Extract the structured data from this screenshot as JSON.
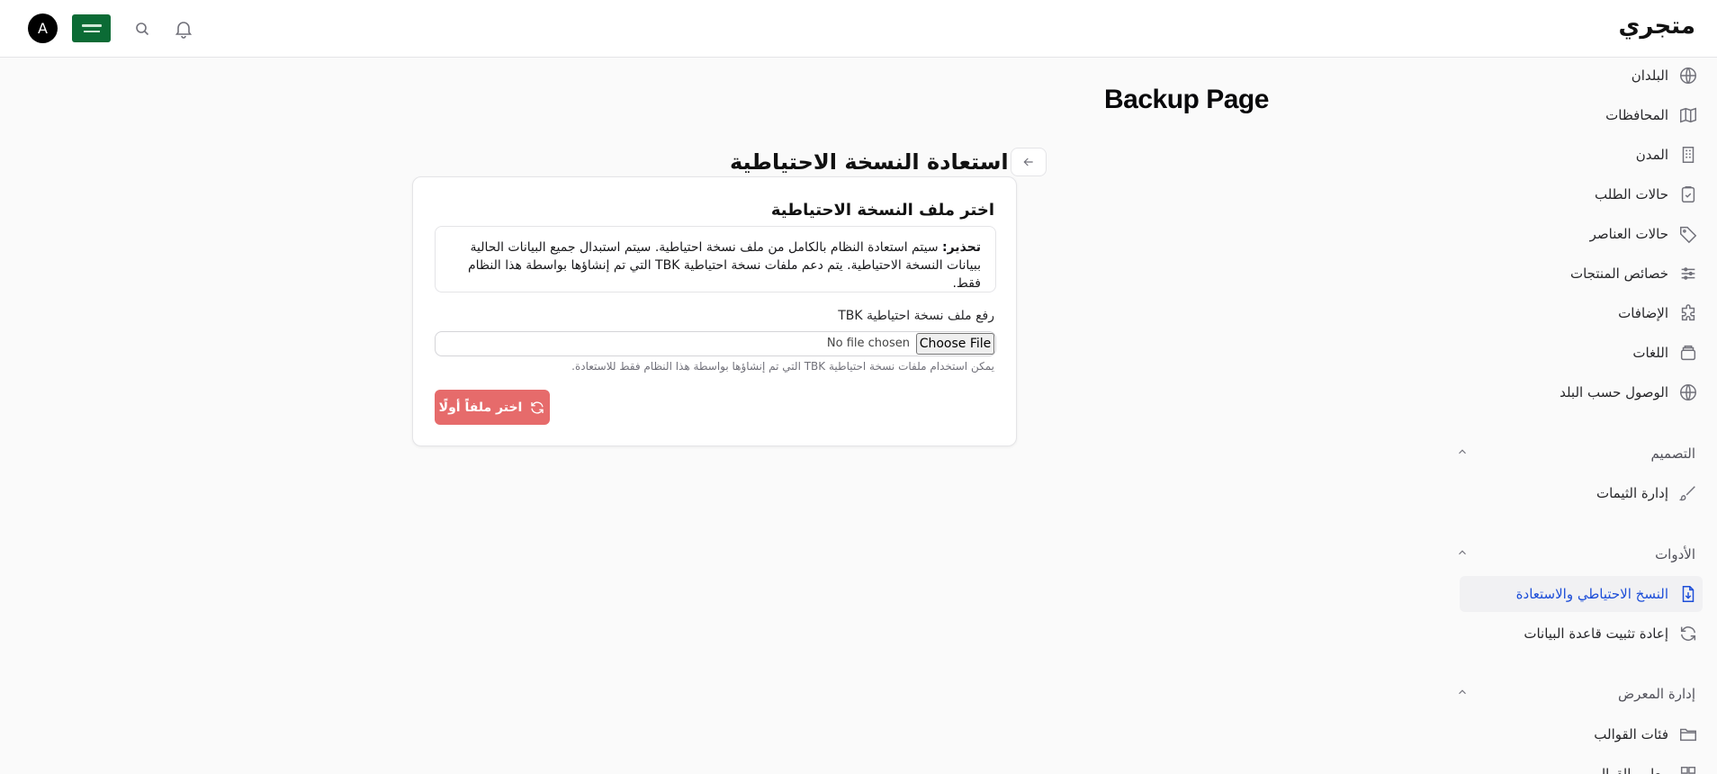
{
  "topbar": {
    "brand": "متجري",
    "avatar_letter": "A",
    "icons": [
      "bell-icon",
      "search-icon",
      "flag-icon"
    ]
  },
  "sidebar": {
    "items_top": [
      {
        "label": "البلدان",
        "icon": "globe-icon"
      },
      {
        "label": "المحافظات",
        "icon": "map-icon"
      },
      {
        "label": "المدن",
        "icon": "building-icon"
      },
      {
        "label": "حالات الطلب",
        "icon": "clipboard-check-icon"
      },
      {
        "label": "حالات العناصر",
        "icon": "tag-icon"
      },
      {
        "label": "خصائص المنتجات",
        "icon": "sliders-icon"
      },
      {
        "label": "الإضافات",
        "icon": "puzzle-icon"
      },
      {
        "label": "اللغات",
        "icon": "layers-icon"
      },
      {
        "label": "الوصول حسب البلد",
        "icon": "globe-icon"
      }
    ],
    "sections": [
      {
        "title": "التصميم",
        "items": [
          {
            "label": "إدارة الثيمات",
            "icon": "brush-icon"
          }
        ]
      },
      {
        "title": "الأدوات",
        "items": [
          {
            "label": "النسخ الاحتياطي والاستعادة",
            "icon": "file-download-icon",
            "active": true
          },
          {
            "label": "إعادة تثبيت قاعدة البيانات",
            "icon": "refresh-icon"
          }
        ]
      },
      {
        "title": "إدارة المعرض",
        "items": [
          {
            "label": "فئات القوالب",
            "icon": "folder-icon"
          },
          {
            "label": "معايير القوالب",
            "icon": "grid-icon"
          }
        ]
      }
    ]
  },
  "main": {
    "page_title": "Backup Page",
    "heading": "استعادة النسخة الاحتياطية",
    "card": {
      "title": "اختر ملف النسخة الاحتياطية",
      "warning_label": "تحذير:",
      "warning_text": " سيتم استعادة النظام بالكامل من ملف نسخة احتياطية. سيتم استبدال جميع البيانات الحالية ببيانات النسخة الاحتياطية. يتم دعم ملفات نسخة احتياطية TBK التي تم إنشاؤها بواسطة هذا النظام فقط.",
      "field_label": "رفع ملف نسخة احتياطية TBK",
      "choose_file": "Choose File",
      "no_file": "No file chosen",
      "help_text": "يمكن استخدام ملفات نسخة احتياطية TBK التي تم إنشاؤها بواسطة هذا النظام فقط للاستعادة.",
      "submit_label": "اختر ملفاً أولًا",
      "submit_color": "#e66b6b"
    }
  }
}
